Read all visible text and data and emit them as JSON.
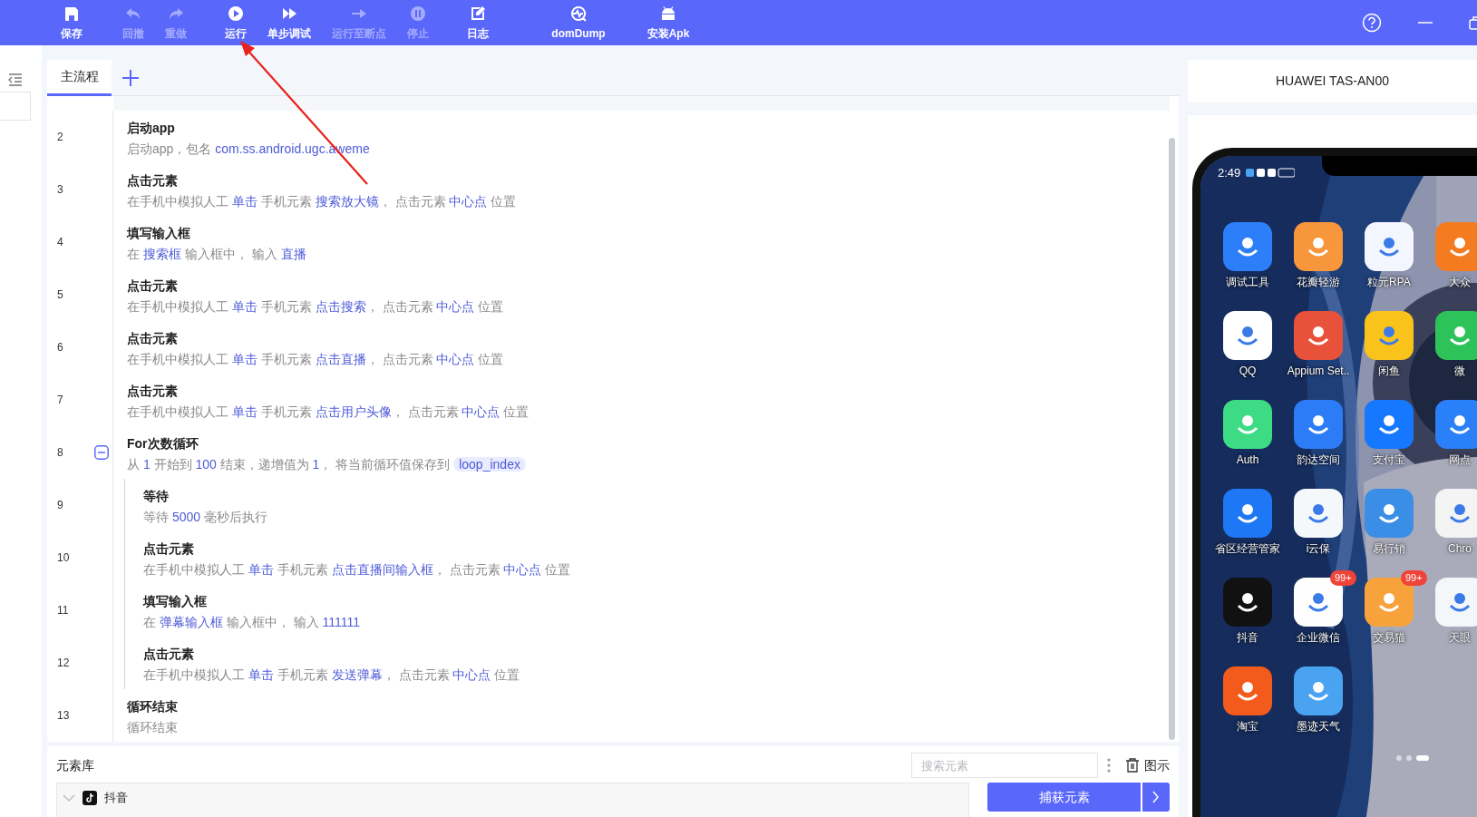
{
  "toolbar": {
    "tools": [
      {
        "label": "保存",
        "kind": "save",
        "disabled": false
      },
      {
        "label": "回撤",
        "kind": "undo",
        "disabled": true
      },
      {
        "label": "重做",
        "kind": "redo",
        "disabled": true
      },
      {
        "label": "运行",
        "kind": "run",
        "disabled": false
      },
      {
        "label": "单步调试",
        "kind": "step",
        "disabled": false
      },
      {
        "label": "运行至断点",
        "kind": "run_to",
        "disabled": true
      },
      {
        "label": "停止",
        "kind": "stop",
        "disabled": true
      },
      {
        "label": "日志",
        "kind": "log",
        "disabled": false
      },
      {
        "label": "domDump",
        "kind": "dump",
        "disabled": false
      },
      {
        "label": "安装Apk",
        "kind": "apk",
        "disabled": false
      }
    ]
  },
  "tabs": [
    {
      "label": "主流程",
      "selected": true
    }
  ],
  "flow": {
    "steps": [
      {
        "number": "2",
        "title": "启动app",
        "description": [
          {
            "kind": "text",
            "text": "启动app，包名 "
          },
          {
            "kind": "value",
            "text": "com.ss.android.ugc.aweme"
          }
        ]
      },
      {
        "number": "3",
        "title": "点击元素",
        "description": [
          {
            "kind": "text",
            "text": "在手机中模拟人工 "
          },
          {
            "kind": "value",
            "text": "单击"
          },
          {
            "kind": "text",
            "text": " 手机元素 "
          },
          {
            "kind": "value",
            "text": "搜索放大镜"
          },
          {
            "kind": "text",
            "text": "， 点击元素 "
          },
          {
            "kind": "value",
            "text": "中心点"
          },
          {
            "kind": "text",
            "text": " 位置"
          }
        ]
      },
      {
        "number": "4",
        "title": "填写输入框",
        "description": [
          {
            "kind": "text",
            "text": "在 "
          },
          {
            "kind": "value",
            "text": "搜索框"
          },
          {
            "kind": "text",
            "text": " 输入框中， 输入 "
          },
          {
            "kind": "value",
            "text": "直播"
          }
        ]
      },
      {
        "number": "5",
        "title": "点击元素",
        "description": [
          {
            "kind": "text",
            "text": "在手机中模拟人工 "
          },
          {
            "kind": "value",
            "text": "单击"
          },
          {
            "kind": "text",
            "text": " 手机元素 "
          },
          {
            "kind": "value",
            "text": "点击搜索"
          },
          {
            "kind": "text",
            "text": "， 点击元素 "
          },
          {
            "kind": "value",
            "text": "中心点"
          },
          {
            "kind": "text",
            "text": " 位置"
          }
        ]
      },
      {
        "number": "6",
        "title": "点击元素",
        "description": [
          {
            "kind": "text",
            "text": "在手机中模拟人工 "
          },
          {
            "kind": "value",
            "text": "单击"
          },
          {
            "kind": "text",
            "text": " 手机元素 "
          },
          {
            "kind": "value",
            "text": "点击直播"
          },
          {
            "kind": "text",
            "text": "， 点击元素 "
          },
          {
            "kind": "value",
            "text": "中心点"
          },
          {
            "kind": "text",
            "text": " 位置"
          }
        ]
      },
      {
        "number": "7",
        "title": "点击元素",
        "description": [
          {
            "kind": "text",
            "text": "在手机中模拟人工 "
          },
          {
            "kind": "value",
            "text": "单击"
          },
          {
            "kind": "text",
            "text": " 手机元素 "
          },
          {
            "kind": "value",
            "text": "点击用户头像"
          },
          {
            "kind": "text",
            "text": "， 点击元素 "
          },
          {
            "kind": "value",
            "text": "中心点"
          },
          {
            "kind": "text",
            "text": " 位置"
          }
        ]
      },
      {
        "number": "8",
        "title": "For次数循环",
        "expanded": true,
        "description": [
          {
            "kind": "text",
            "text": "从 "
          },
          {
            "kind": "value",
            "text": "1"
          },
          {
            "kind": "text",
            "text": " 开始到 "
          },
          {
            "kind": "value",
            "text": "100"
          },
          {
            "kind": "text",
            "text": " 结束，递增值为 "
          },
          {
            "kind": "value",
            "text": "1"
          },
          {
            "kind": "text",
            "text": "， 将当前循环值保存到 "
          },
          {
            "kind": "tag",
            "text": "loop_index"
          }
        ],
        "children": [
          {
            "number": "9",
            "title": "等待",
            "description": [
              {
                "kind": "text",
                "text": "等待 "
              },
              {
                "kind": "value",
                "text": "5000"
              },
              {
                "kind": "text",
                "text": " 毫秒后执行"
              }
            ]
          },
          {
            "number": "10",
            "title": "点击元素",
            "description": [
              {
                "kind": "text",
                "text": "在手机中模拟人工 "
              },
              {
                "kind": "value",
                "text": "单击"
              },
              {
                "kind": "text",
                "text": " 手机元素 "
              },
              {
                "kind": "value",
                "text": "点击直播间输入框"
              },
              {
                "kind": "text",
                "text": "， 点击元素 "
              },
              {
                "kind": "value",
                "text": "中心点"
              },
              {
                "kind": "text",
                "text": " 位置"
              }
            ]
          },
          {
            "number": "11",
            "title": "填写输入框",
            "description": [
              {
                "kind": "text",
                "text": "在 "
              },
              {
                "kind": "value",
                "text": "弹幕输入框"
              },
              {
                "kind": "text",
                "text": " 输入框中， 输入 "
              },
              {
                "kind": "value",
                "text": "111111"
              }
            ]
          },
          {
            "number": "12",
            "title": "点击元素",
            "description": [
              {
                "kind": "text",
                "text": "在手机中模拟人工 "
              },
              {
                "kind": "value",
                "text": "单击"
              },
              {
                "kind": "text",
                "text": " 手机元素 "
              },
              {
                "kind": "value",
                "text": "发送弹幕"
              },
              {
                "kind": "text",
                "text": "， 点击元素 "
              },
              {
                "kind": "value",
                "text": "中心点"
              },
              {
                "kind": "text",
                "text": " 位置"
              }
            ]
          }
        ]
      },
      {
        "number": "13",
        "title": "循环结束",
        "description": [
          {
            "kind": "text",
            "text": "循环结束"
          }
        ]
      }
    ]
  },
  "element_library": {
    "title": "元素库",
    "search": {
      "placeholder": "搜索元素"
    },
    "legend": "图示",
    "tree": [
      {
        "label": "抖音",
        "expanded": true
      }
    ],
    "capture_button": "捕获元素"
  },
  "device": {
    "name": "HUAWEI TAS-AN00",
    "phone": {
      "time": "2:49",
      "apps": [
        {
          "label": "调试工具",
          "color": "#2d7ff9"
        },
        {
          "label": "花瓣轻游",
          "color": "#f7963a"
        },
        {
          "label": "粒元RPA",
          "color": "#f4f6ff"
        },
        {
          "label": "大众",
          "color": "#f57b20"
        },
        {
          "label": "QQ",
          "color": "#ffffff"
        },
        {
          "label": "Appium Set..",
          "color": "#e8523a"
        },
        {
          "label": "闲鱼",
          "color": "#f9c31b"
        },
        {
          "label": "微",
          "color": "#2ec25a"
        },
        {
          "label": "Auth",
          "color": "#3ddc84"
        },
        {
          "label": "韵达空间",
          "color": "#2b7cf6"
        },
        {
          "label": "支付宝",
          "color": "#1677ff"
        },
        {
          "label": "网点",
          "color": "#2a80f8"
        },
        {
          "label": "省区经营管家",
          "color": "#1e78f5"
        },
        {
          "label": "i云保",
          "color": "#f4f8fb"
        },
        {
          "label": "易行销",
          "color": "#3a8ee6"
        },
        {
          "label": "Chro",
          "color": "#f4f4f4"
        },
        {
          "label": "抖音",
          "color": "#111111"
        },
        {
          "label": "企业微信",
          "color": "#fefefe",
          "badge": "99+"
        },
        {
          "label": "交易猫",
          "color": "#f8a23b",
          "badge": "99+"
        },
        {
          "label": "天眼",
          "color": "#f3f7fa"
        },
        {
          "label": "淘宝",
          "color": "#f35b1c"
        },
        {
          "label": "墨迹天气",
          "color": "#4aa3f0"
        }
      ],
      "pages": [
        {
          "selected": false
        },
        {
          "selected": false
        },
        {
          "selected": true
        }
      ]
    }
  }
}
